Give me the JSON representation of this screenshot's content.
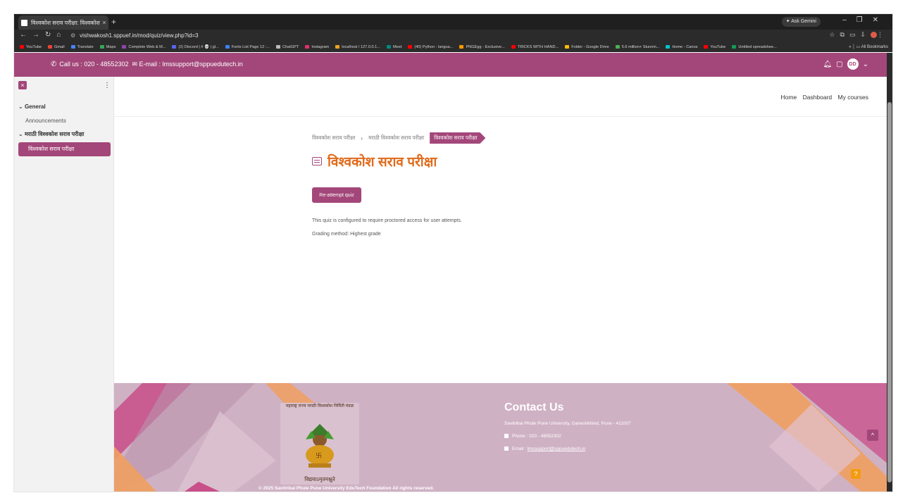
{
  "browser": {
    "tab_title": "विश्वकोश सराव परीक्षा: विश्वकोश स",
    "tab_close": "×",
    "new_tab": "+",
    "gemini": "✦ Ask Gemini",
    "url": "vishwakosh1.sppuef.in/mod/quiz/view.php?id=3",
    "all_bookmarks": "All Bookmarks",
    "bookmarks": [
      {
        "label": "YouTube",
        "color": "#ff0000"
      },
      {
        "label": "Gmail",
        "color": "#ea4335"
      },
      {
        "label": "Translate",
        "color": "#4285f4"
      },
      {
        "label": "Maps",
        "color": "#34a853"
      },
      {
        "label": "Complete Web & M...",
        "color": "#8e44ad"
      },
      {
        "label": "(2) Discord | # 💀 | gl...",
        "color": "#5865f2"
      },
      {
        "label": "Fonts List Page 12 :...",
        "color": "#3b82f6"
      },
      {
        "label": "ChatGPT",
        "color": "#bbbbbb"
      },
      {
        "label": "Instagram",
        "color": "#e1306c"
      },
      {
        "label": "localhost / 127.0.0.1...",
        "color": "#f0a020"
      },
      {
        "label": "Meet",
        "color": "#00897b"
      },
      {
        "label": "(40) Python : langua...",
        "color": "#ff0000"
      },
      {
        "label": "PNGEgg - Exclusive...",
        "color": "#ff9800"
      },
      {
        "label": "TRICKS WITH HAND...",
        "color": "#ff0000"
      },
      {
        "label": "Folder - Google Drive",
        "color": "#fbbc04"
      },
      {
        "label": "5.6 million+ Stunnin...",
        "color": "#4caf50"
      },
      {
        "label": "Home - Canva",
        "color": "#00c4cc"
      },
      {
        "label": "YouTube",
        "color": "#ff0000"
      },
      {
        "label": "Untitled spreadshee...",
        "color": "#0f9d58"
      }
    ]
  },
  "header": {
    "call": "Call us : 020 - 48552302",
    "email": "E-mail : lmssupport@sppuedutech.in",
    "avatar": "DD"
  },
  "sidebar": {
    "close": "×",
    "sections": [
      {
        "title": "General",
        "items": [
          "Announcements"
        ]
      },
      {
        "title": "मराठी विश्वकोश सराव परीक्षा",
        "items": []
      }
    ],
    "active_item": "विश्वकोश सराव परीक्षा"
  },
  "nav": {
    "links": [
      "Home",
      "Dashboard",
      "My courses"
    ]
  },
  "breadcrumb": [
    "विश्वकोश सराव परीक्षा",
    "मराठी विश्वकोश सराव परीक्षा",
    "विश्वकोश सराव परीक्षा"
  ],
  "page": {
    "title": "विश्वकोश सराव परीक्षा",
    "reattempt_label": "Re-attempt quiz",
    "proctor_info": "This quiz is configured to require proctored access for user attempts.",
    "grading": "Grading method: Highest grade"
  },
  "footer": {
    "logo_motto": "विद्ययाऽमृतमश्नुते",
    "logo_arc": "महाराष्ट्र राज्य मराठी विश्वकोश निर्मिती मंडळ",
    "contact_title": "Contact Us",
    "address": "Savitribai Phule Pune University, Ganeshkhind, Pune - 411007",
    "phone": "Phone : 020 - 48552302",
    "email_label": "Email :",
    "email": "lmssupport@sppuedutech.in",
    "copyright": "© 2025 Savitribai Phule Pune University EduTech Foundation All rights reserved.",
    "scroll_top": "^",
    "help": "?"
  }
}
